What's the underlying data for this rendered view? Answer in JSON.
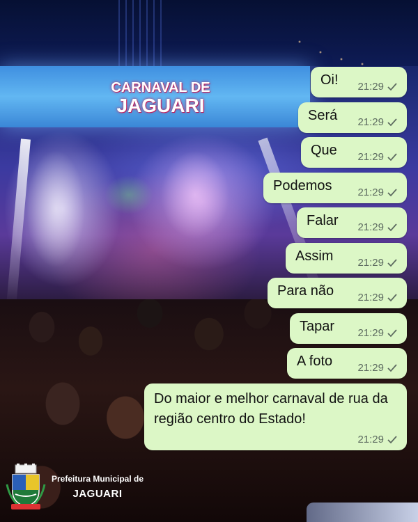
{
  "event_logo": {
    "line1": "CARNAVAL DE",
    "line2": "JAGUARI"
  },
  "chat": {
    "messages": [
      {
        "text": "Oi!",
        "time": "21:29"
      },
      {
        "text": "Será",
        "time": "21:29"
      },
      {
        "text": "Que",
        "time": "21:29"
      },
      {
        "text": "Podemos",
        "time": "21:29"
      },
      {
        "text": "Falar",
        "time": "21:29"
      },
      {
        "text": "Assim",
        "time": "21:29"
      },
      {
        "text": "Para não",
        "time": "21:29"
      },
      {
        "text": "Tapar",
        "time": "21:29"
      },
      {
        "text": "A foto",
        "time": "21:29"
      },
      {
        "text": "Do maior e melhor carnaval de rua da região centro do Estado!",
        "time": "21:29"
      }
    ],
    "status_icon": "single-check-icon",
    "bubble_color": "#dcf7c6"
  },
  "brand": {
    "line1": "Prefeitura Municipal de",
    "line2": "JAGUARI",
    "icon": "municipal-crest-icon"
  }
}
